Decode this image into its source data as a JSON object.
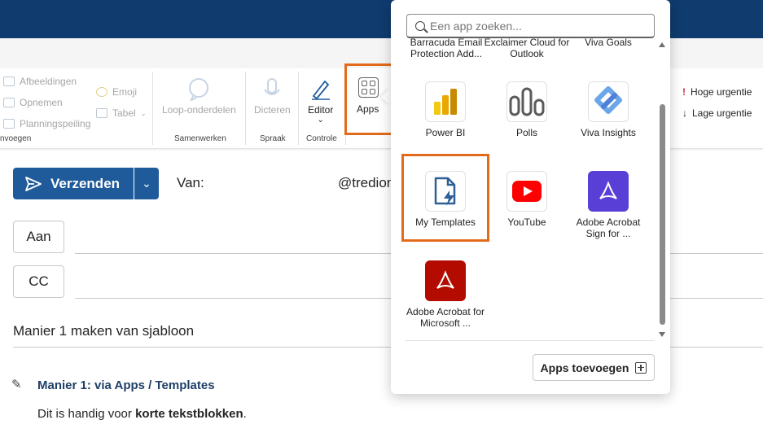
{
  "ribbon": {
    "insert": {
      "images": "Afbeeldingen",
      "record": "Opnemen",
      "poll": "Planningspeiling",
      "emoji": "Emoji",
      "table": "Tabel",
      "group": "nvoegen"
    },
    "collab": {
      "loop": "Loop-onderdelen",
      "group": "Samenwerken"
    },
    "speech": {
      "dictate": "Dicteren",
      "group": "Spraak"
    },
    "control": {
      "editor": "Editor",
      "group": "Controle"
    },
    "apps": {
      "label": "Apps"
    },
    "urgency": {
      "high": "Hoge urgentie",
      "low": "Lage urgentie"
    }
  },
  "compose": {
    "send": "Verzenden",
    "from_label": "Van:",
    "from_value": "@tredion",
    "to": "Aan",
    "cc": "CC",
    "subject": "Manier 1 maken van sjabloon",
    "body_heading": "Manier 1: via Apps / Templates",
    "body_text_pre": "Dit is handig voor ",
    "body_text_bold": "korte tekstblokken",
    "body_text_post": "."
  },
  "flyout": {
    "search_placeholder": "Een app zoeken...",
    "partial_row": [
      "Barracuda Email Protection Add...",
      "Exclaimer Cloud for Outlook",
      "Viva Goals"
    ],
    "apps": [
      {
        "name": "Power BI",
        "icon": "powerbi-icon"
      },
      {
        "name": "Polls",
        "icon": "polls-icon"
      },
      {
        "name": "Viva Insights",
        "icon": "viva-insights-icon"
      },
      {
        "name": "My Templates",
        "icon": "my-templates-icon"
      },
      {
        "name": "YouTube",
        "icon": "youtube-icon"
      },
      {
        "name": "Adobe Acrobat Sign for ...",
        "icon": "adobe-sign-icon"
      },
      {
        "name": "Adobe Acrobat for Microsoft ...",
        "icon": "adobe-acrobat-icon"
      }
    ],
    "add_apps": "Apps toevoegen"
  },
  "colors": {
    "accent": "#1f5b9a",
    "highlight": "#e26b1b",
    "titlebar": "#0f3b6e"
  }
}
